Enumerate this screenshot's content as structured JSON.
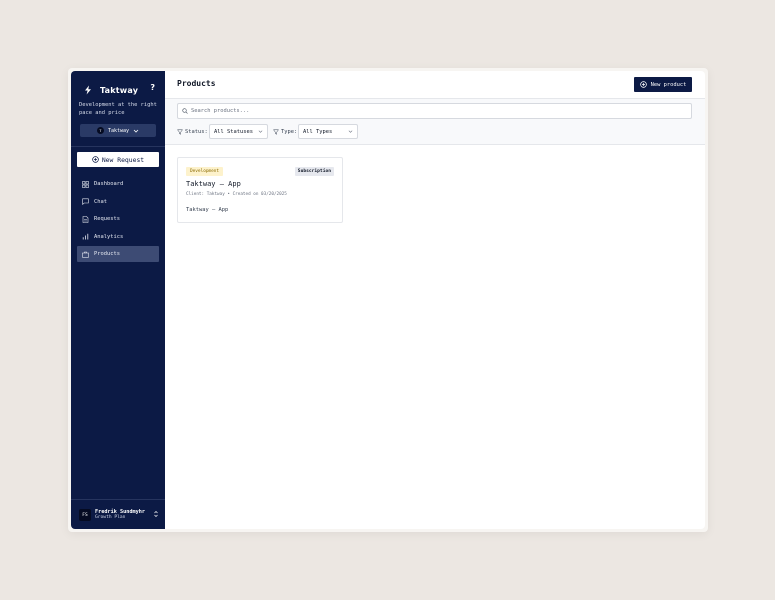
{
  "sidebar": {
    "brand": "Taktway",
    "help": "?",
    "tagline": "Development at the right pace and price",
    "workspace": {
      "logo": "T",
      "name": "Taktway"
    },
    "new_request": "New Request",
    "nav": [
      {
        "label": "Dashboard",
        "icon": "dashboard-icon"
      },
      {
        "label": "Chat",
        "icon": "chat-icon"
      },
      {
        "label": "Requests",
        "icon": "document-icon"
      },
      {
        "label": "Analytics",
        "icon": "bar-chart-icon"
      },
      {
        "label": "Products",
        "icon": "briefcase-icon",
        "active": true
      }
    ],
    "user": {
      "initials": "FS",
      "name": "Fredrik Sundmyhr",
      "plan": "Growth Plan"
    }
  },
  "header": {
    "title": "Products",
    "new_product": "New product"
  },
  "filters": {
    "search_placeholder": "Search products...",
    "status_label": "Status:",
    "status_value": "All Statuses",
    "type_label": "Type:",
    "type_value": "All Types"
  },
  "products": [
    {
      "status": "Development",
      "type": "Subscription",
      "title": "Taktway – App",
      "meta": "Client: Taktway • Created on 03/20/2025",
      "description": "Taktway – App"
    }
  ],
  "colors": {
    "sidebar_bg": "#0c1a45",
    "accent": "#0c1a45",
    "status_badge_bg": "#fdf2cc",
    "background": "#ece7e2"
  }
}
